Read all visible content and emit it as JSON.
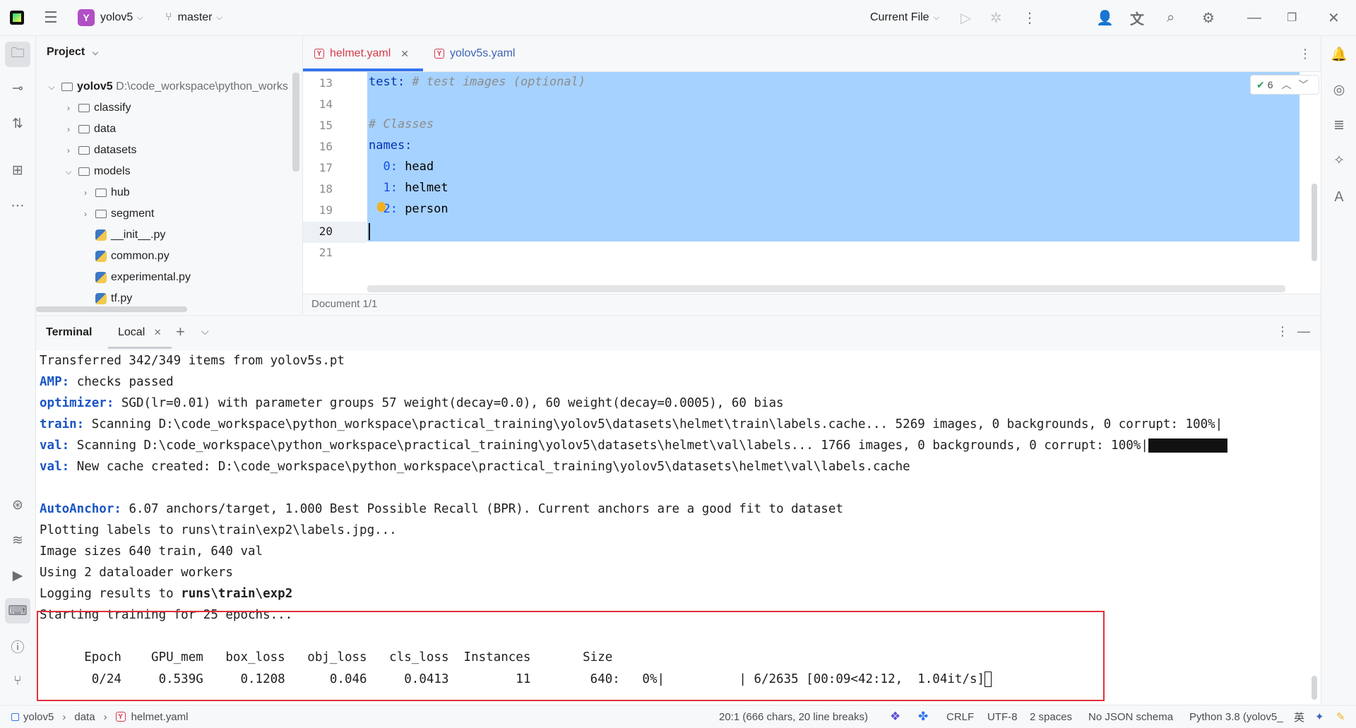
{
  "titlebar": {
    "project_badge": "Y",
    "project": "yolov5",
    "branch": "master",
    "run_config": "Current File",
    "icons": [
      "run-icon",
      "debug-icon",
      "more-icon",
      "add-user-icon",
      "translate-icon",
      "search-icon",
      "gear-icon",
      "minimize-icon",
      "restore-icon",
      "close-icon"
    ]
  },
  "project_panel": {
    "title": "Project",
    "root": {
      "name": "yolov5",
      "path": "D:\\code_workspace\\python_works"
    },
    "items": [
      {
        "label": "classify",
        "type": "folder"
      },
      {
        "label": "data",
        "type": "folder"
      },
      {
        "label": "datasets",
        "type": "folder"
      },
      {
        "label": "models",
        "type": "folder"
      },
      {
        "label": "hub",
        "type": "folder"
      },
      {
        "label": "segment",
        "type": "folder"
      },
      {
        "label": "__init__.py",
        "type": "file"
      },
      {
        "label": "common.py",
        "type": "file"
      },
      {
        "label": "experimental.py",
        "type": "file"
      },
      {
        "label": "tf.py",
        "type": "file"
      }
    ]
  },
  "editor": {
    "tabs": [
      {
        "label": "helmet.yaml",
        "active": true
      },
      {
        "label": "yolov5s.yaml",
        "active": false
      }
    ],
    "problems_count": "6",
    "line_numbers": [
      "13",
      "14",
      "15",
      "16",
      "17",
      "18",
      "19",
      "20",
      "21"
    ],
    "lines": {
      "l13_key": "test:",
      "l13_cmt": " # test images (optional)",
      "l15_cmt": "# Classes",
      "l16_key": "names:",
      "l17_num": "  0:",
      "l17_val": " head",
      "l18_num": "  1:",
      "l18_val": " helmet",
      "l19_num": "  2:",
      "l19_val": " person"
    },
    "status": "Document 1/1"
  },
  "terminal": {
    "title": "Terminal",
    "tab": "Local",
    "lines": [
      {
        "pre": "",
        "text": "Transferred 342/349 items from yolov5s.pt"
      },
      {
        "pre": "AMP:",
        "text": " checks passed"
      },
      {
        "pre": "optimizer:",
        "text": " SGD(lr=0.01) with parameter groups 57 weight(decay=0.0), 60 weight(decay=0.0005), 60 bias"
      },
      {
        "pre": "train:",
        "text": " Scanning D:\\code_workspace\\python_workspace\\practical_training\\yolov5\\datasets\\helmet\\train\\labels.cache... 5269 images, 0 backgrounds, 0 corrupt: 100%|"
      },
      {
        "pre": "val:",
        "text": " Scanning D:\\code_workspace\\python_workspace\\practical_training\\yolov5\\datasets\\helmet\\val\\labels... 1766 images, 0 backgrounds, 0 corrupt: 100%|"
      },
      {
        "pre": "val:",
        "text": " New cache created: D:\\code_workspace\\python_workspace\\practical_training\\yolov5\\datasets\\helmet\\val\\labels.cache"
      },
      {
        "pre": "",
        "text": ""
      },
      {
        "pre": "AutoAnchor:",
        "text": " 6.07 anchors/target, 1.000 Best Possible Recall (BPR). Current anchors are a good fit to dataset"
      },
      {
        "pre": "",
        "text": "Plotting labels to runs\\train\\exp2\\labels.jpg..."
      },
      {
        "pre": "",
        "text": "Image sizes 640 train, 640 val"
      },
      {
        "pre": "",
        "text": "Using 2 dataloader workers"
      },
      {
        "pre": "",
        "text": "Logging results to "
      },
      {
        "pre": "",
        "text": "Starting training for 25 epochs..."
      },
      {
        "pre": "",
        "text": ""
      },
      {
        "pre": "",
        "text": "      Epoch    GPU_mem   box_loss   obj_loss   cls_loss  Instances       Size"
      },
      {
        "pre": "",
        "text": "       0/24     0.539G     0.1208      0.046     0.0413         11        640:   0%|          | 6/2635 [00:09<42:12,  1.04it/s]"
      }
    ],
    "logging_dir": "runs\\train\\exp2"
  },
  "statusbar": {
    "crumbs": [
      "yolov5",
      "data",
      "helmet.yaml"
    ],
    "position": "20:1 (666 chars, 20 line breaks)",
    "line_sep": "CRLF",
    "encoding": "UTF-8",
    "indent": "2 spaces",
    "schema": "No JSON schema",
    "interpreter": "Python 3.8 (yolov5_",
    "ime": "英"
  }
}
